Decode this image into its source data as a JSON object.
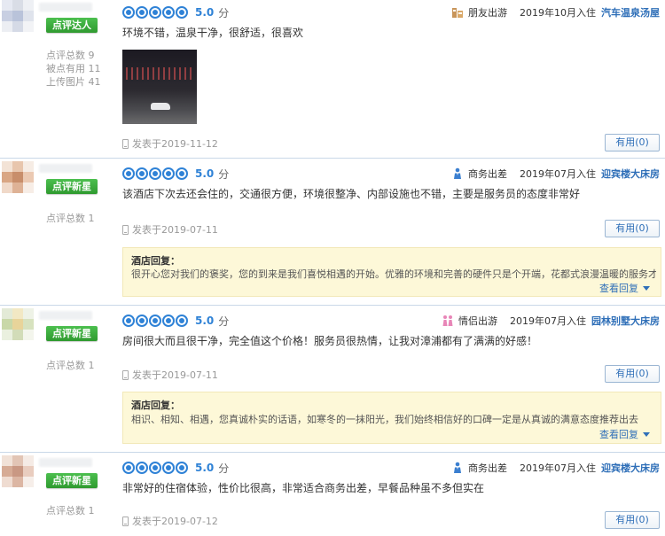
{
  "reviews": [
    {
      "badge": "点评达人",
      "stats": [
        "点评总数 9",
        "被点有用 11",
        "上传图片 41"
      ],
      "score": "5.0",
      "score_unit": "分",
      "trip_type": "朋友出游",
      "stay_date": "2019年10月入住",
      "room": "汽车温泉汤屋",
      "content": "环境不错，温泉干净，很舒适，很喜欢",
      "post_date": "发表于2019-11-12",
      "useful": "有用(0)"
    },
    {
      "badge": "点评新星",
      "stats": [
        "点评总数 1"
      ],
      "score": "5.0",
      "score_unit": "分",
      "trip_type": "商务出差",
      "stay_date": "2019年07月入住",
      "room": "迎宾楼大床房",
      "content": "该酒店下次去还会住的，交通很方便，环境很整净、内部设施也不错，主要是服务员的态度非常好",
      "post_date": "发表于2019-07-11",
      "useful": "有用(0)",
      "reply_title": "酒店回复：",
      "reply_body": "很开心您对我们的褒奖，您的到来是我们喜悦相遇的开始。优雅的环境和完善的硬件只是个开端，花都式浪漫温暖的服务才是我",
      "reply_more": "查看回复"
    },
    {
      "badge": "点评新星",
      "stats": [
        "点评总数 1"
      ],
      "score": "5.0",
      "score_unit": "分",
      "trip_type": "情侣出游",
      "stay_date": "2019年07月入住",
      "room": "园林别墅大床房",
      "content": "房间很大而且很干净，完全值这个价格！服务员很热情，让我对漳浦都有了满满的好感！",
      "post_date": "发表于2019-07-11",
      "useful": "有用(0)",
      "reply_title": "酒店回复：",
      "reply_body": "相识、相知、相遇，您真诚朴实的话语，如寒冬的一抹阳光，我们始终相信好的口碑一定是从真诚的满意态度推荐出去",
      "reply_more": "查看回复"
    },
    {
      "badge": "点评新星",
      "stats": [
        "点评总数 1"
      ],
      "score": "5.0",
      "score_unit": "分",
      "trip_type": "商务出差",
      "stay_date": "2019年07月入住",
      "room": "迎宾楼大床房",
      "content": "非常好的住宿体验，性价比很高，非常适合商务出差，早餐品种虽不多但实在",
      "post_date": "发表于2019-07-12",
      "useful": "有用(0)"
    }
  ],
  "colors": {
    "accent": "#2f82d6",
    "link": "#2f6fb8",
    "badge_green": "#2f9a2f",
    "reply_bg": "#fdf8d8"
  },
  "icons": {
    "trip_friends": "friends-icon",
    "trip_business": "business-icon",
    "trip_couple": "couple-icon",
    "device": "phone-icon"
  }
}
